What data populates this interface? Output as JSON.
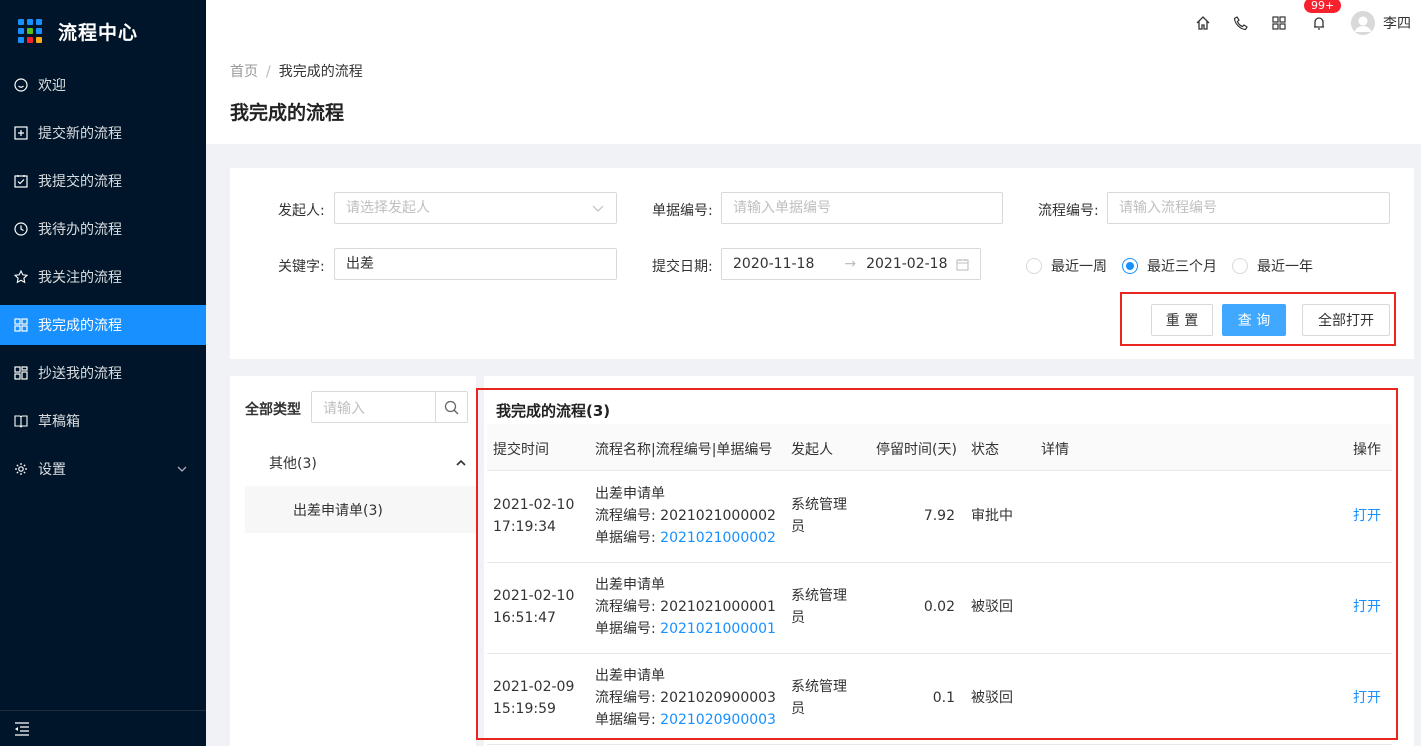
{
  "app": {
    "title": "流程中心"
  },
  "sidebar": {
    "items": [
      {
        "label": "欢迎",
        "icon": "smile-icon"
      },
      {
        "label": "提交新的流程",
        "icon": "plus-square-icon"
      },
      {
        "label": "我提交的流程",
        "icon": "check-square-icon"
      },
      {
        "label": "我待办的流程",
        "icon": "clock-icon"
      },
      {
        "label": "我关注的流程",
        "icon": "star-icon"
      },
      {
        "label": "我完成的流程",
        "icon": "appstore-icon",
        "active": true
      },
      {
        "label": "抄送我的流程",
        "icon": "cc-icon"
      },
      {
        "label": "草稿箱",
        "icon": "book-icon"
      },
      {
        "label": "设置",
        "icon": "gear-icon"
      }
    ]
  },
  "header": {
    "badge": "99+",
    "user": "李四"
  },
  "breadcrumb": {
    "home": "首页",
    "sep": "/",
    "current": "我完成的流程"
  },
  "page": {
    "title": "我完成的流程"
  },
  "filter": {
    "initiator_label": "发起人:",
    "initiator_placeholder": "请选择发起人",
    "doc_no_label": "单据编号:",
    "doc_no_placeholder": "请输入单据编号",
    "flow_no_label": "流程编号:",
    "flow_no_placeholder": "请输入流程编号",
    "keyword_label": "关键字:",
    "keyword_value": "出差",
    "date_label": "提交日期:",
    "date_start": "2020-11-18",
    "date_sep": "→",
    "date_end": "2021-02-18",
    "radio_week": "最近一周",
    "radio_3months": "最近三个月",
    "radio_year": "最近一年",
    "reset_label": "重 置",
    "query_label": "查 询",
    "open_all_label": "全部打开"
  },
  "tree": {
    "label": "全部类型",
    "search_placeholder": "请输入",
    "node": "其他(3)",
    "leaf": "出差申请单(3)"
  },
  "table": {
    "title": "我完成的流程(3)",
    "headers": [
      "提交时间",
      "流程名称|流程编号|单据编号",
      "发起人",
      "停留时间(天)",
      "状态",
      "详情",
      "操作"
    ],
    "flow_no_prefix": "流程编号: ",
    "doc_no_prefix": "单据编号: ",
    "rows": [
      {
        "date": "2021-02-10",
        "time": "17:19:34",
        "name": "出差申请单",
        "flow_no": "2021021000002",
        "doc_no": "2021021000002",
        "initiator_1": "系统管理",
        "initiator_2": "员",
        "days": "7.92",
        "status": "审批中",
        "action": "打开"
      },
      {
        "date": "2021-02-10",
        "time": "16:51:47",
        "name": "出差申请单",
        "flow_no": "2021021000001",
        "doc_no": "2021021000001",
        "initiator_1": "系统管理",
        "initiator_2": "员",
        "days": "0.02",
        "status": "被驳回",
        "action": "打开"
      },
      {
        "date": "2021-02-09",
        "time": "15:19:59",
        "name": "出差申请单",
        "flow_no": "2021020900003",
        "doc_no": "2021020900003",
        "initiator_1": "系统管理",
        "initiator_2": "员",
        "days": "0.1",
        "status": "被驳回",
        "action": "打开"
      }
    ]
  },
  "colors": {
    "sidebar_bg": "#001529",
    "primary": "#1890ff",
    "highlight": "#e8251e"
  }
}
